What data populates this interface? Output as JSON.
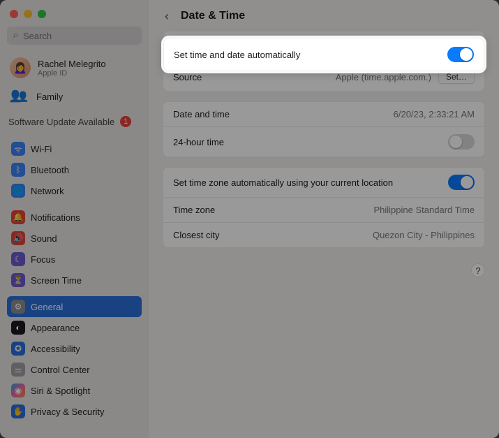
{
  "sidebar": {
    "search_placeholder": "Search",
    "user": {
      "name": "Rachel Melegrito",
      "sub": "Apple ID"
    },
    "family_label": "Family",
    "software_update": {
      "label": "Software Update Available",
      "count": "1"
    },
    "items": [
      {
        "label": "Wi-Fi"
      },
      {
        "label": "Bluetooth"
      },
      {
        "label": "Network"
      },
      {
        "label": "Notifications"
      },
      {
        "label": "Sound"
      },
      {
        "label": "Focus"
      },
      {
        "label": "Screen Time"
      },
      {
        "label": "General"
      },
      {
        "label": "Appearance"
      },
      {
        "label": "Accessibility"
      },
      {
        "label": "Control Center"
      },
      {
        "label": "Siri & Spotlight"
      },
      {
        "label": "Privacy & Security"
      }
    ]
  },
  "header": {
    "title": "Date & Time"
  },
  "panels": {
    "auto": {
      "label": "Set time and date automatically",
      "source_label": "Source",
      "source_value": "Apple (time.apple.com.)",
      "set_button": "Set…"
    },
    "datetime": {
      "date_label": "Date and time",
      "date_value": "6/20/23, 2:33:21 AM",
      "twentyfour_label": "24-hour time"
    },
    "timezone": {
      "auto_label": "Set time zone automatically using your current location",
      "zone_label": "Time zone",
      "zone_value": "Philippine Standard Time",
      "city_label": "Closest city",
      "city_value": "Quezon City - Philippines"
    }
  },
  "help_label": "?"
}
